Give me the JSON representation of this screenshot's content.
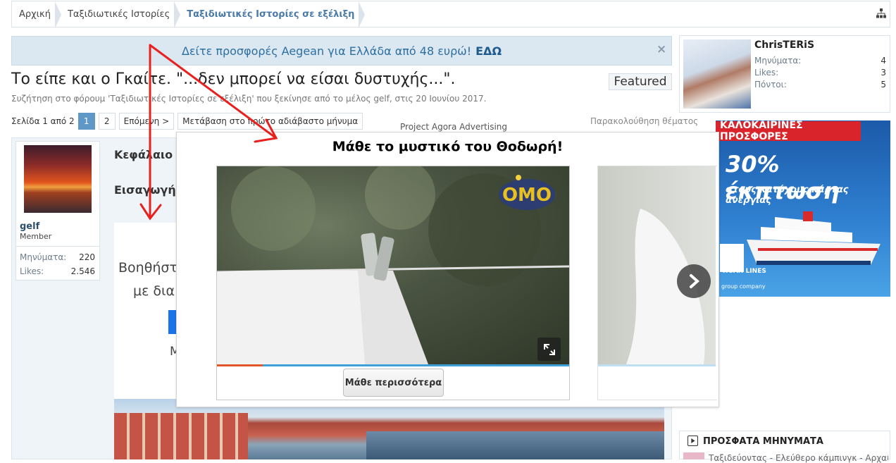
{
  "breadcrumb": {
    "items": [
      "Αρχική",
      "Ταξιδιωτικές Ιστορίες",
      "Ταξιδιωτικές Ιστορίες σε εξέλιξη"
    ]
  },
  "notice": {
    "text": "Δείτε προσφορές Aegean για Ελλάδα από 48 ευρώ!",
    "link": "ΕΔΩ",
    "close": "×"
  },
  "thread": {
    "title": "Το είπε και ο Γκαίτε. \"...δεν μπορεί να είσαι δυστυχής...\".",
    "featured": "Featured",
    "subtitle": "Συζήτηση στο φόρουμ 'Ταξιδιωτικές Ιστορίες σε εξέλιξη' που ξεκίνησε από το μέλος gelf, στις 20 Ιουνίου 2017."
  },
  "pager": {
    "label": "Σελίδα 1 από 2",
    "pages": [
      "1",
      "2"
    ],
    "next": "Επόμενη >",
    "goto": "Μετάβαση στο πρώτο αδιάβαστο μήνυμα",
    "right": "Παρακολούθηση θέματος"
  },
  "post": {
    "user": {
      "name": "gelf",
      "role": "Member",
      "messages_label": "Μηνύματα:",
      "messages": "220",
      "likes_label": "Likes:",
      "likes": "2.546"
    },
    "heading1": "Κεφάλαιο",
    "heading2": "Εισαγωγή",
    "ad_line1": "Βοηθήστ",
    "ad_line2": "με δια",
    "ad_line3": "Μ"
  },
  "sidebar": {
    "user": {
      "name": "ChrisTERiS",
      "messages_label": "Μηνύματα:",
      "messages": "4",
      "likes_label": "Likes:",
      "likes": "3",
      "points_label": "Πόντοι:",
      "points": "5"
    },
    "ad": {
      "banner": "ΚΑΛΟΚΑΙΡΙΝΕΣ ΠΡΟΣΦΟΡΕΣ",
      "headline": "30% έκπτωση",
      "sub": "στους κατόχους κάρτας ανεργίας",
      "brand": "NOAN LINES",
      "group": "group company"
    },
    "recent": {
      "title": "ΠΡΟΣΦΑΤΑ ΜΗΝΥΜΑΤΑ",
      "first_item": "Ταξιδεύοντας - Ελεύθερο κάμπινγκ - Αρχαία"
    }
  },
  "overlay": {
    "label": "Project Agora Advertising",
    "title": "Μάθε το μυστικό του Θοδωρή!",
    "learn_more": "Μάθε περισσότερα",
    "brand": "OMO",
    "progress": 0.13
  },
  "colors": {
    "accent": "#5f97c7",
    "notice_bg": "#dbe8f2",
    "annotation_red": "#e8201e",
    "progress_played": "#e2572a",
    "progress_track": "#3ea0d8"
  }
}
